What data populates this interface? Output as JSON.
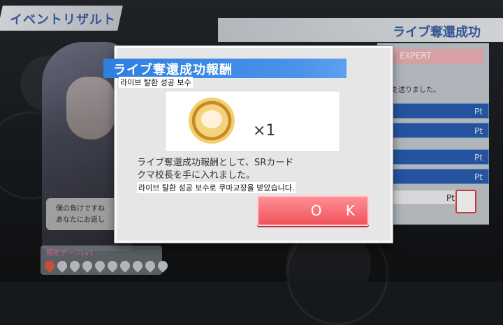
{
  "header": {
    "event_result_tab": "イベントリザルト",
    "live_title_tab": "ライブ奪還成功"
  },
  "side_panel": {
    "difficulty": "EXPERT",
    "note": "を送りました。",
    "pt_label": "Pt"
  },
  "character": {
    "speech_line_1": "僕の負けですね",
    "speech_line_2": "あなたにお返し",
    "level_label": "親密ゲージLv1"
  },
  "dialog": {
    "title": "ライブ奪還成功報酬",
    "subtitle_ko": "라이브 탈환 성공 보수",
    "reward_quantity": "×1",
    "description_line_1": "ライブ奪還成功報酬として、SRカード",
    "description_line_2": "クマ校長を手に入れました。",
    "description_ko": "라이브 탈환 성공 보수로 쿠마교장을 받았습니다.",
    "ok_label": "O K"
  },
  "colors": {
    "title_blue": "#2f7fe0",
    "ok_red": "#f0545c",
    "expert_pink": "#f0b4b6"
  }
}
